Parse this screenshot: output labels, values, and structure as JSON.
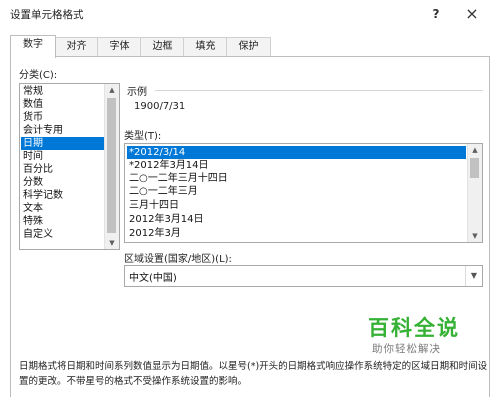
{
  "dialog": {
    "title": "设置单元格格式",
    "help_glyph": "?",
    "close_glyph": "×"
  },
  "tabs": [
    "数字",
    "对齐",
    "字体",
    "边框",
    "填充",
    "保护"
  ],
  "active_tab": "数字",
  "category": {
    "label": "分类(C):",
    "items": [
      "常规",
      "数值",
      "货币",
      "会计专用",
      "日期",
      "时间",
      "百分比",
      "分数",
      "科学记数",
      "文本",
      "特殊",
      "自定义"
    ],
    "selected": "日期"
  },
  "sample": {
    "label": "示例",
    "value": "1900/7/31"
  },
  "type": {
    "label": "类型(T):",
    "items": [
      "*2012/3/14",
      "*2012年3月14日",
      "二○一二年三月十四日",
      "二○一二年三月",
      "三月十四日",
      "2012年3月14日",
      "2012年3月"
    ],
    "selected": "*2012/3/14"
  },
  "locale": {
    "label": "区域设置(国家/地区)(L):",
    "value": "中文(中国)"
  },
  "watermark": {
    "title": "百科全说",
    "subtitle": "助你轻松解决"
  },
  "description": "日期格式将日期和时间系列数值显示为日期值。以星号(*)开头的日期格式响应操作系统特定的区域日期和时间设置的更改。不带星号的格式不受操作系统设置的影响。",
  "icons": {
    "scroll_up": "up-arrow-icon",
    "scroll_down": "down-arrow-icon",
    "dropdown": "chevron-down-icon"
  }
}
